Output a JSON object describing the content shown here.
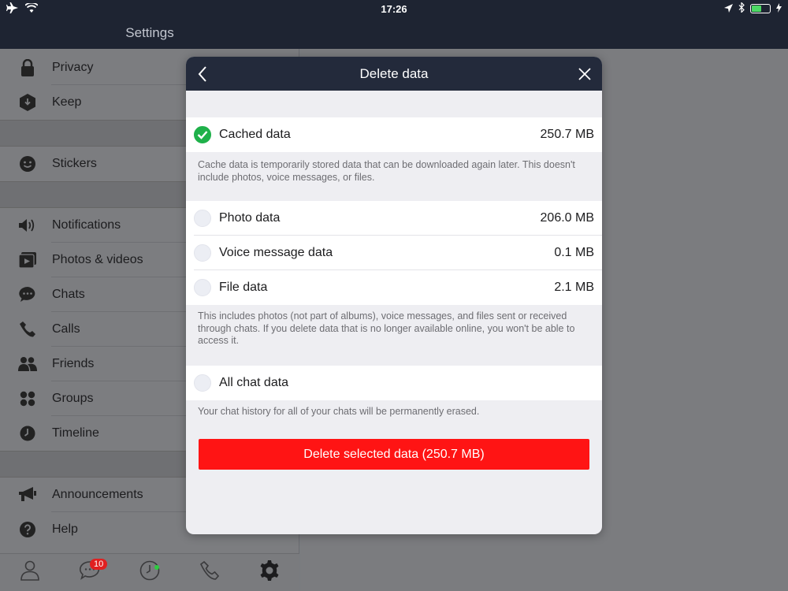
{
  "status": {
    "time": "17:26"
  },
  "sidebar": {
    "title": "Settings",
    "items": [
      {
        "label": "Privacy",
        "icon": "lock-icon"
      },
      {
        "label": "Keep",
        "icon": "keep-icon"
      },
      {
        "label": "Stickers",
        "icon": "sticker-icon"
      },
      {
        "label": "Notifications",
        "icon": "speaker-icon"
      },
      {
        "label": "Photos & videos",
        "icon": "photo-video-icon"
      },
      {
        "label": "Chats",
        "icon": "chat-bubble-icon"
      },
      {
        "label": "Calls",
        "icon": "phone-icon"
      },
      {
        "label": "Friends",
        "icon": "friends-icon"
      },
      {
        "label": "Groups",
        "icon": "groups-icon"
      },
      {
        "label": "Timeline",
        "icon": "clock-icon"
      },
      {
        "label": "Announcements",
        "icon": "megaphone-icon"
      },
      {
        "label": "Help",
        "icon": "help-icon"
      }
    ]
  },
  "tabbar": {
    "chat_badge": "10"
  },
  "modal": {
    "title": "Delete data",
    "cached": {
      "label": "Cached data",
      "size": "250.7 MB",
      "checked": true
    },
    "cached_note": "Cache data is temporarily stored data that can be downloaded again later. This doesn't include photos, voice messages, or files.",
    "photo": {
      "label": "Photo data",
      "size": "206.0 MB",
      "checked": false
    },
    "voice": {
      "label": "Voice message data",
      "size": "0.1 MB",
      "checked": false
    },
    "file": {
      "label": "File data",
      "size": "2.1 MB",
      "checked": false
    },
    "media_note": "This includes photos (not part of albums), voice messages, and files sent or received through chats. If you delete data that is no longer available online, you won't be able to access it.",
    "allchat": {
      "label": "All chat data",
      "checked": false
    },
    "allchat_note": "Your chat history for all of your chats will be permanently erased.",
    "delete_label": "Delete selected data (250.7 MB)"
  },
  "colors": {
    "delete_button": "#ff1414",
    "check_on": "#1fb14a",
    "header": "#232a3b"
  }
}
